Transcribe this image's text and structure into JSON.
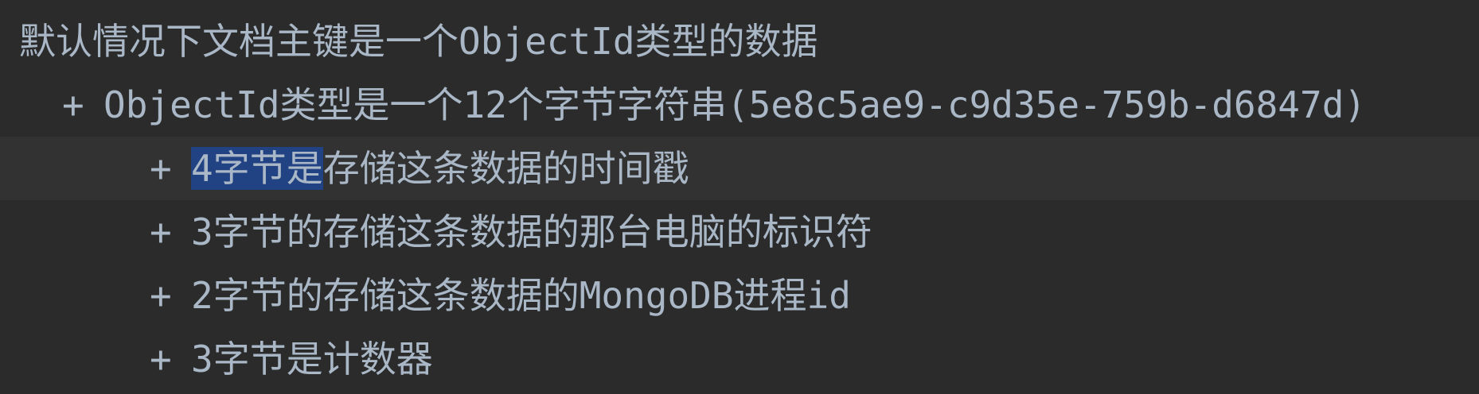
{
  "editor": {
    "lines": [
      {
        "bullet": "",
        "selected": "",
        "text": "默认情况下文档主键是一个ObjectId类型的数据"
      },
      {
        "bullet": "+",
        "selected": "",
        "text": "ObjectId类型是一个12个字节字符串(5e8c5ae9-c9d35e-759b-d6847d)"
      },
      {
        "bullet": "+",
        "selected": "4字节是",
        "text": "存储这条数据的时间戳"
      },
      {
        "bullet": "+",
        "selected": "",
        "text": "3字节的存储这条数据的那台电脑的标识符"
      },
      {
        "bullet": "+",
        "selected": "",
        "text": "2字节的存储这条数据的MongoDB进程id"
      },
      {
        "bullet": "+",
        "selected": "",
        "text": "3字节是计数器"
      }
    ]
  },
  "colors": {
    "background": "#2b2b2b",
    "current_line": "#323232",
    "selection": "#214283",
    "text": "#a9b7c6",
    "gutter_marker": "#d8a42b"
  }
}
